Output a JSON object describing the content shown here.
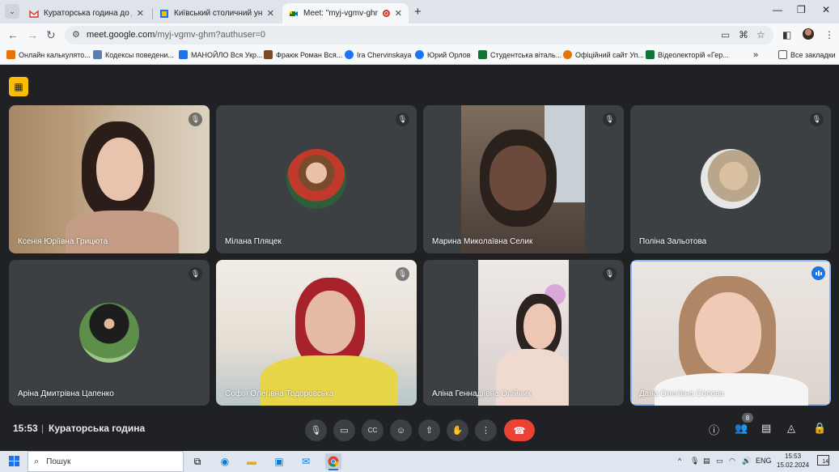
{
  "browser": {
    "tabs": [
      {
        "title": "Кураторська година до Дня в",
        "favicon": "gmail-icon",
        "active": false
      },
      {
        "title": "Київський столичний універс",
        "favicon": "university-icon",
        "active": false
      },
      {
        "title": "Meet: \"myj-vgmv-ghm\"",
        "favicon": "meet-icon",
        "active": true,
        "recording": true
      }
    ],
    "url_host": "meet.google.com",
    "url_path": "/myj-vgmv-ghm?authuser=0",
    "bookmarks": [
      {
        "label": "Онлайн калькулято...",
        "color": "#e8710a"
      },
      {
        "label": "Кодексы поведени...",
        "color": "#5b7db1"
      },
      {
        "label": "МАНОЙЛО Вся Укр...",
        "color": "#1a73e8"
      },
      {
        "label": "Фраюк Роман Вся...",
        "color": "#7a4a2a"
      },
      {
        "label": "Ira Chervinskaya",
        "color": "#1877f2"
      },
      {
        "label": "Юрий Орлов",
        "color": "#1877f2"
      },
      {
        "label": "Студентська віталь...",
        "color": "#137333"
      },
      {
        "label": "Офіційний сайт Уп...",
        "color": "#e37400"
      },
      {
        "label": "Відеолекторій «Гер...",
        "color": "#137333"
      }
    ],
    "all_bookmarks": "Все закладки"
  },
  "participants": [
    {
      "name": "Ксенія Юріївна Грицюта",
      "type": "video",
      "muted": true
    },
    {
      "name": "Мілана Пляцек",
      "type": "avatar",
      "muted": true
    },
    {
      "name": "Марина Миколаївна Селик",
      "type": "video",
      "muted": true
    },
    {
      "name": "Поліна Зальотова",
      "type": "avatar",
      "muted": true
    },
    {
      "name": "Аріна Дмитрівна Цапенко",
      "type": "avatar",
      "muted": true
    },
    {
      "name": "Софія Олегівна Тодоровська",
      "type": "video",
      "muted": true
    },
    {
      "name": "Аліна Геннадіївна Олійник",
      "type": "video",
      "muted": true
    },
    {
      "name": "Дана Олегівна Сопова",
      "type": "video",
      "muted": false,
      "speaking": true
    }
  ],
  "call": {
    "time": "15:53",
    "separator": "|",
    "title": "Кураторська година",
    "participant_count": "8"
  },
  "taskbar": {
    "search_placeholder": "Пошук",
    "lang": "ENG",
    "time": "15:53",
    "date": "15.02.2024",
    "notifications": "14"
  },
  "colors": {
    "meet_bg": "#202124",
    "tile_bg": "#3c4043",
    "end_call": "#ea4335",
    "speaking_outline": "#8ab4f8",
    "badge_yellow": "#fbbc04"
  }
}
